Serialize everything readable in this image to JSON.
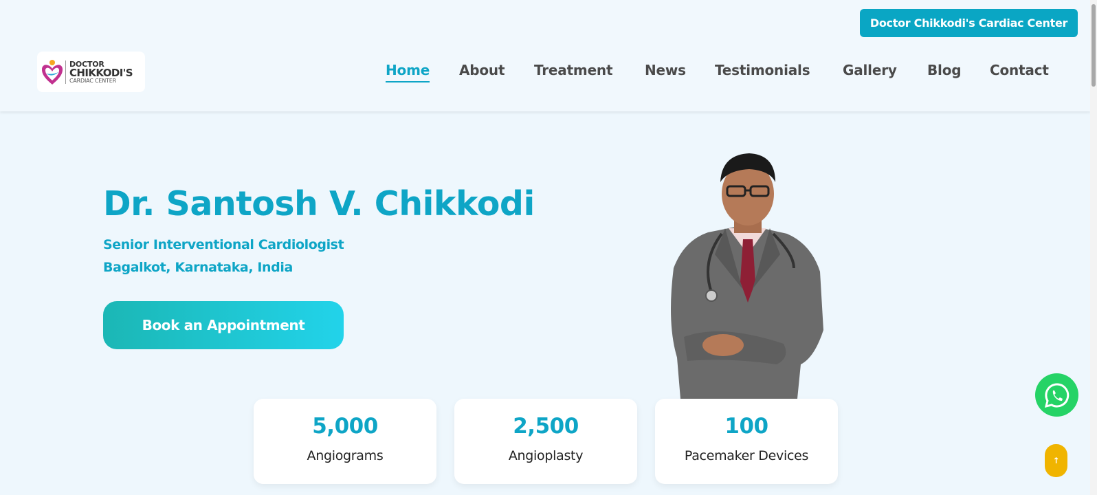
{
  "header": {
    "top_button": "Doctor Chikkodi's Cardiac Center",
    "logo": {
      "line1": "DOCTOR",
      "line2": "CHIKKODI'S",
      "line3": "CARDIAC CENTER"
    },
    "nav": [
      "Home",
      "About",
      "Treatment",
      "News",
      "Testimonials",
      "Gallery",
      "Blog",
      "Contact"
    ],
    "active_nav": "Home"
  },
  "hero": {
    "title": "Dr. Santosh V. Chikkodi",
    "subtitle1": "Senior Interventional Cardiologist",
    "subtitle2": "Bagalkot, Karnataka, India",
    "cta": "Book an Appointment"
  },
  "stats": [
    {
      "value": "5,000",
      "label": "Angiograms"
    },
    {
      "value": "2,500",
      "label": "Angioplasty"
    },
    {
      "value": "100",
      "label": "Pacemaker Devices"
    }
  ],
  "floating": {
    "whatsapp_icon": "whatsapp-icon",
    "to_top_label": "↑"
  },
  "colors": {
    "accent": "#0ea5c6",
    "button_gradient_start": "#1bb7b5",
    "button_gradient_end": "#22d3ea",
    "whatsapp": "#25d366",
    "to_top": "#f0b400"
  }
}
